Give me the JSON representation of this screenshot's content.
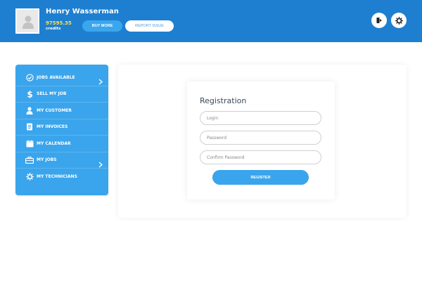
{
  "header": {
    "user_name": "Henry Wasserman",
    "credits_amount": "97595.35",
    "credits_label": "credits",
    "buy_more_label": "BUY MORE",
    "report_issue_label": "REPORT ISSUE",
    "icons": [
      "exit-icon",
      "gear-icon"
    ]
  },
  "colors": {
    "header_bg": "#1e7fd0",
    "accent": "#3aa5ec",
    "credits": "#ffe24a"
  },
  "sidebar": {
    "items": [
      {
        "label": "JOBS AVAILABLE",
        "icon": "check-circle-icon",
        "has_chevron": true
      },
      {
        "label": "SELL MY JOB",
        "icon": "dollar-icon",
        "has_chevron": false
      },
      {
        "label": "MY CUSTOMER",
        "icon": "user-icon",
        "has_chevron": false
      },
      {
        "label": "MY INVOICES",
        "icon": "invoice-icon",
        "has_chevron": false
      },
      {
        "label": "MY CALENDAR",
        "icon": "calendar-icon",
        "has_chevron": false
      },
      {
        "label": "MY JOBS",
        "icon": "briefcase-icon",
        "has_chevron": true
      },
      {
        "label": "MY TECHNICIANS",
        "icon": "cog-icon",
        "has_chevron": false
      }
    ]
  },
  "registration": {
    "title": "Registration",
    "login_placeholder": "Login",
    "password_placeholder": "Password",
    "confirm_placeholder": "Confirm Password",
    "register_label": "REGISTER"
  }
}
